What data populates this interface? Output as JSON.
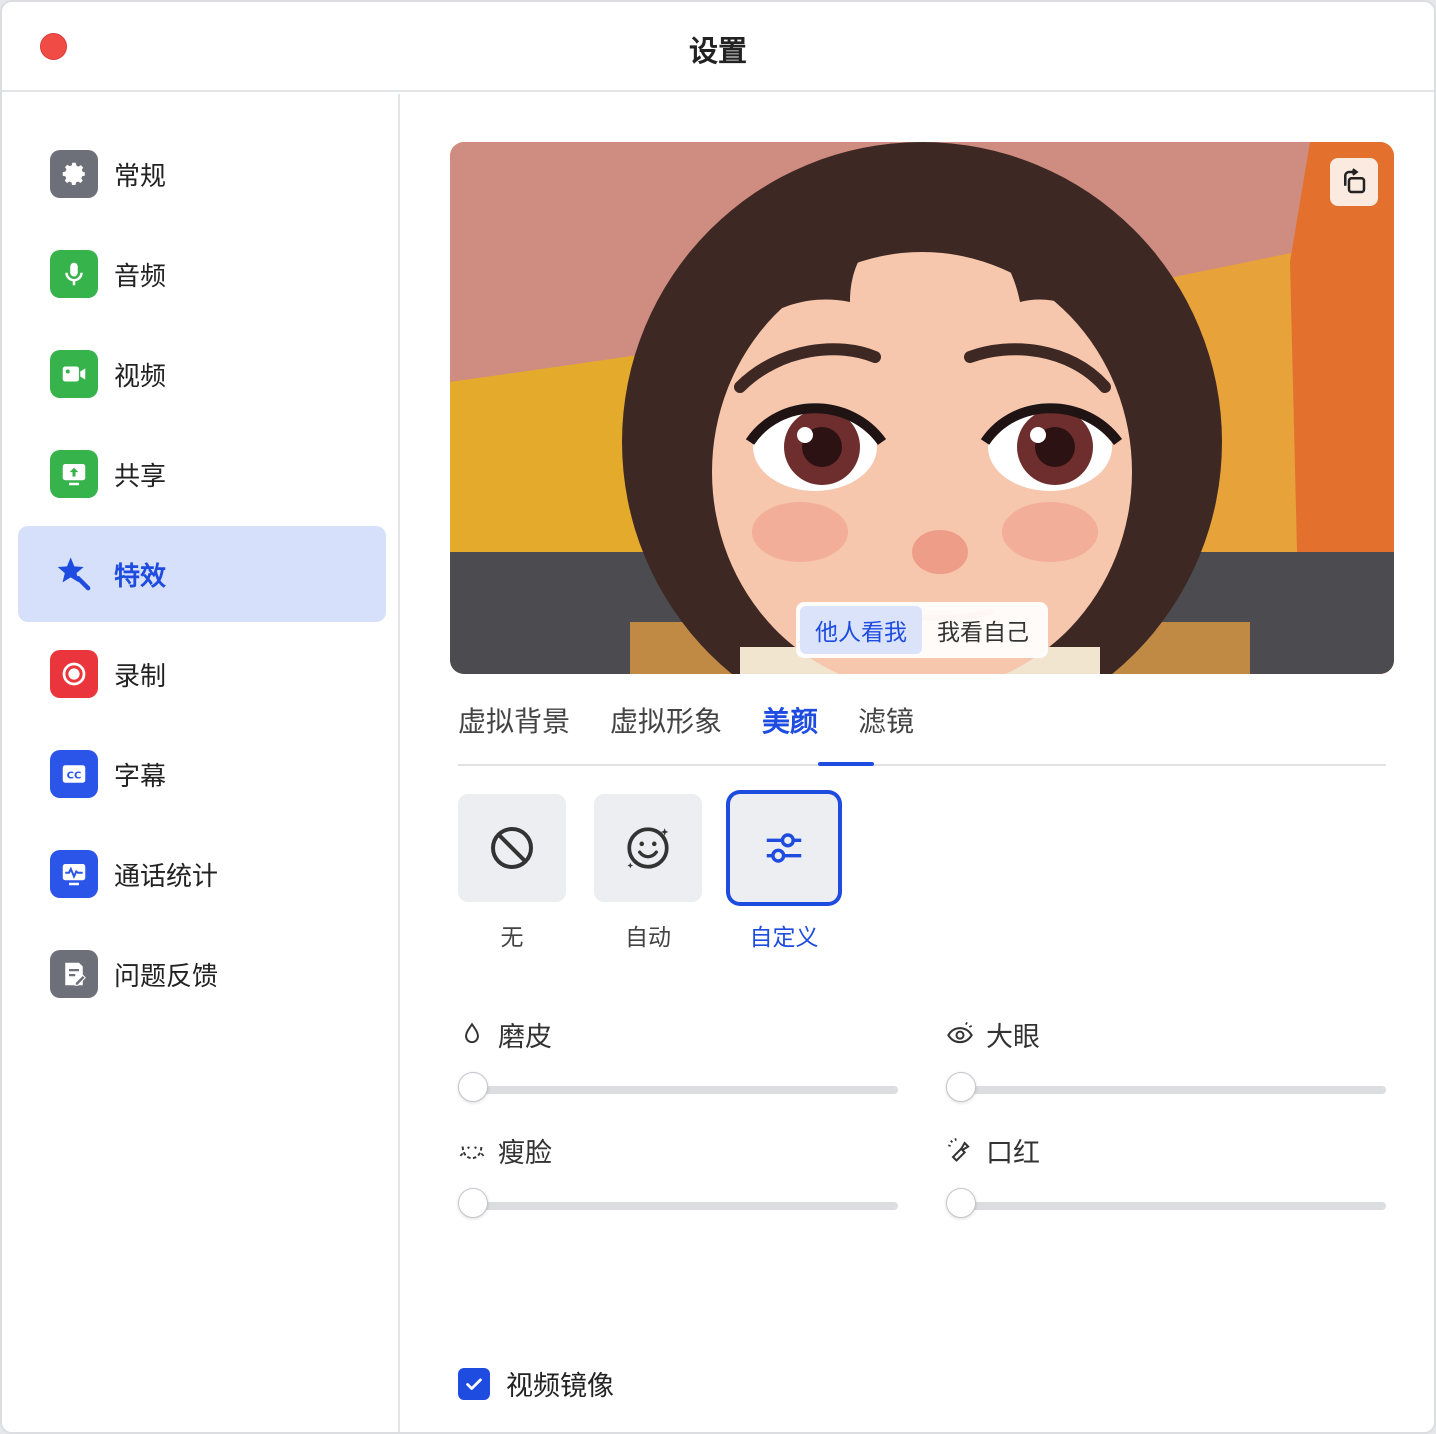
{
  "window": {
    "title": "设置"
  },
  "sidebar": {
    "items": [
      {
        "label": "常规",
        "icon": "gear-icon",
        "color": "#6e7079"
      },
      {
        "label": "音频",
        "icon": "microphone-icon",
        "color": "#36b34a"
      },
      {
        "label": "视频",
        "icon": "video-camera-icon",
        "color": "#36b34a"
      },
      {
        "label": "共享",
        "icon": "share-screen-icon",
        "color": "#36b34a"
      },
      {
        "label": "特效",
        "icon": "magic-star-icon",
        "color": "#1e4be0",
        "active": true
      },
      {
        "label": "录制",
        "icon": "record-icon",
        "color": "#e9353b"
      },
      {
        "label": "字幕",
        "icon": "cc-icon",
        "color": "#2a55e8"
      },
      {
        "label": "通话统计",
        "icon": "statistics-icon",
        "color": "#2a55e8"
      },
      {
        "label": "问题反馈",
        "icon": "feedback-icon",
        "color": "#6e7079"
      }
    ]
  },
  "preview": {
    "view_options": [
      "他人看我",
      "我看自己"
    ],
    "selected_view": "他人看我"
  },
  "tabs": {
    "items": [
      "虚拟背景",
      "虚拟形象",
      "美颜",
      "滤镜"
    ],
    "active": "美颜"
  },
  "beauty": {
    "presets": [
      {
        "label": "无",
        "icon": "none-icon"
      },
      {
        "label": "自动",
        "icon": "smiley-sparkle-icon"
      },
      {
        "label": "自定义",
        "icon": "sliders-icon",
        "active": true
      }
    ],
    "sliders": [
      {
        "label": "磨皮",
        "icon": "droplet-icon",
        "value": 0
      },
      {
        "label": "大眼",
        "icon": "eye-icon",
        "value": 0
      },
      {
        "label": "瘦脸",
        "icon": "face-slim-icon",
        "value": 0
      },
      {
        "label": "口红",
        "icon": "lipstick-icon",
        "value": 0
      }
    ]
  },
  "mirror": {
    "label": "视频镜像",
    "checked": true
  },
  "colors": {
    "accent": "#1e4be0",
    "active_bg": "#d6e0fa"
  }
}
